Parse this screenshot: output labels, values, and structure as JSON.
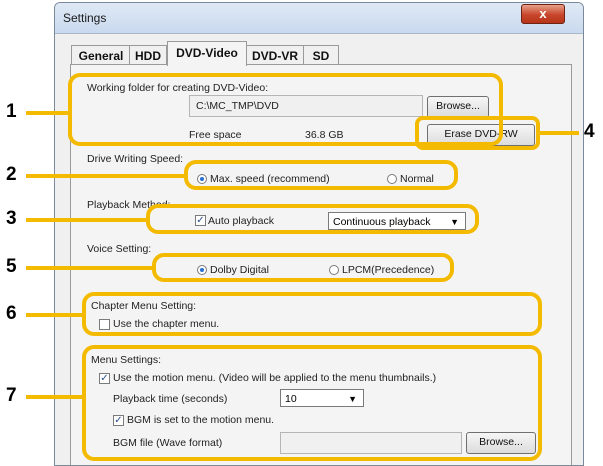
{
  "window": {
    "title": "Settings",
    "close_glyph": "x"
  },
  "tabs": [
    {
      "label": "General"
    },
    {
      "label": "HDD"
    },
    {
      "label": "DVD-Video",
      "active": true
    },
    {
      "label": "DVD-VR"
    },
    {
      "label": "SD"
    }
  ],
  "working_folder": {
    "label": "Working folder for creating DVD-Video:",
    "path": "C:\\MC_TMP\\DVD",
    "browse_label": "Browse...",
    "free_space_label": "Free space",
    "free_space_value": "36.8 GB",
    "erase_label": "Erase DVD-RW"
  },
  "drive_speed": {
    "label": "Drive Writing Speed:",
    "option_max": "Max. speed (recommend)",
    "option_normal": "Normal",
    "selected": "Max. speed (recommend)"
  },
  "playback": {
    "label": "Playback Method:",
    "auto_label": "Auto playback",
    "auto_checked": true,
    "mode_value": "Continuous playback"
  },
  "voice": {
    "label": "Voice Setting:",
    "option_dolby": "Dolby Digital",
    "option_lpcm": "LPCM(Precedence)",
    "selected": "Dolby Digital"
  },
  "chapter": {
    "label": "Chapter Menu Setting:",
    "use_label": "Use the chapter menu.",
    "checked": false
  },
  "menu": {
    "label": "Menu Settings:",
    "motion_label": "Use the motion menu. (Video will be applied to the menu thumbnails.)",
    "motion_checked": true,
    "playback_time_label": "Playback time (seconds)",
    "playback_time_value": "10",
    "bgm_label": "BGM is set to the motion menu.",
    "bgm_checked": true,
    "bgm_file_label": "BGM file (Wave format)",
    "bgm_file_value": "",
    "browse_label": "Browse..."
  },
  "callouts": [
    "1",
    "2",
    "3",
    "4",
    "5",
    "6",
    "7"
  ],
  "colors": {
    "highlight": "#f4ba00",
    "radio_dot": "#2a6fd0"
  },
  "icons": {
    "close": "close-icon",
    "dropdown": "chevron-down-icon"
  }
}
